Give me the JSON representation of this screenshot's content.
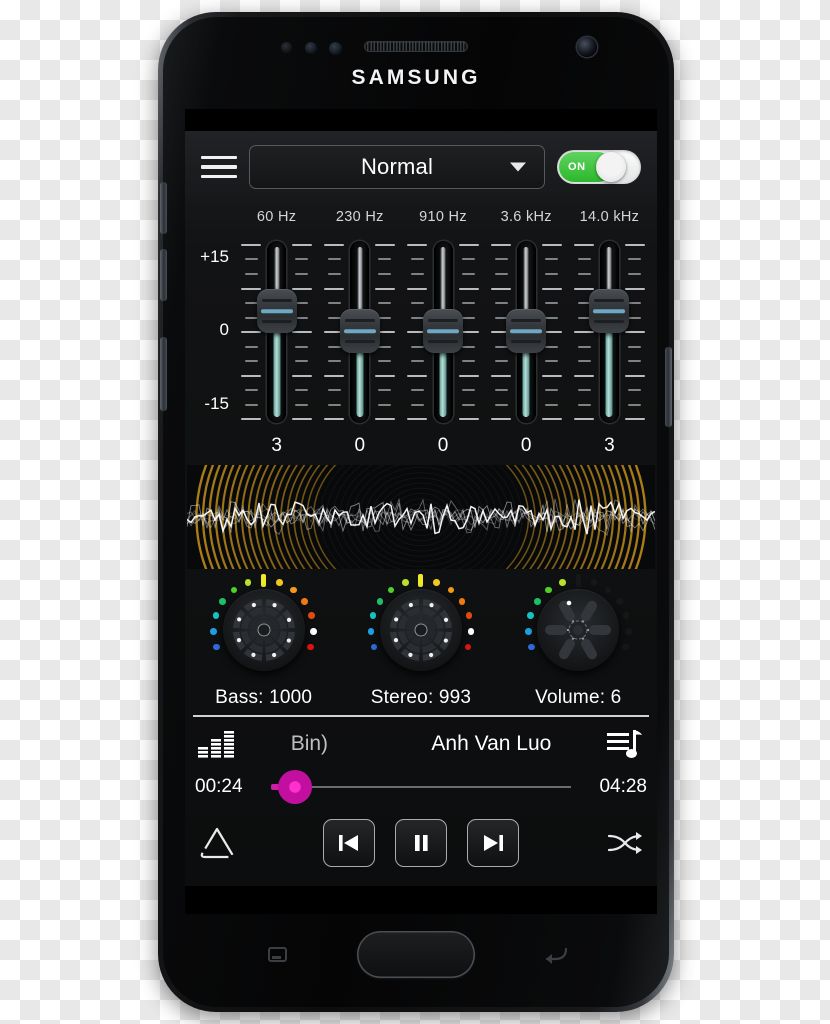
{
  "device": {
    "brand": "SAMSUNG",
    "earpiece": "earpiece-speaker",
    "front_camera": "front-camera",
    "home_button": "home-button",
    "recents_key": "recents-icon",
    "back_key": "back-icon"
  },
  "app": {
    "header": {
      "menu_icon": "hamburger-icon",
      "preset": "Normal",
      "preset_caret": "chevron-down-icon",
      "power_toggle": {
        "label": "ON",
        "state": "on",
        "color": "#2cb82c"
      }
    },
    "equalizer": {
      "axis": {
        "top": "+15",
        "mid": "0",
        "bottom": "-15"
      },
      "bands": [
        {
          "freq": "60 Hz",
          "value": "3",
          "gain": 3
        },
        {
          "freq": "230 Hz",
          "value": "0",
          "gain": 0
        },
        {
          "freq": "910 Hz",
          "value": "0",
          "gain": 0
        },
        {
          "freq": "3.6 kHz",
          "value": "0",
          "gain": 0
        },
        {
          "freq": "14.0 kHz",
          "value": "3",
          "gain": 3
        }
      ],
      "range": [
        -15,
        15
      ],
      "fill_color": "#b6ded7",
      "thumb_line_color": "#6fa8c4"
    },
    "visualizer": {
      "name": "audio-visualizer",
      "wave_color": "#ffffff",
      "ring_color": "#c8921a"
    },
    "knobs": [
      {
        "name": "bass-knob",
        "label": "Bass: 1000",
        "title": "Bass",
        "value": 1000,
        "style": "radial",
        "lit": 13
      },
      {
        "name": "stereo-knob",
        "label": "Stereo: 993",
        "title": "Stereo",
        "value": 993,
        "style": "radial",
        "lit": 13
      },
      {
        "name": "volume-knob",
        "label": "Volume: 6",
        "title": "Volume",
        "value": 6,
        "style": "fan",
        "lit": 6
      }
    ],
    "player": {
      "eq_bars_icon": "equalizer-bars-icon",
      "playlist_icon": "playlist-music-icon",
      "track_tail": "Bin)",
      "track_title": "Anh Van Luo",
      "elapsed": "00:24",
      "duration": "04:28",
      "progress_percent": 8,
      "progress_color": "#cc1fa8",
      "repeat_icon": "repeat-icon",
      "shuffle_icon": "shuffle-icon",
      "previous_icon": "skip-previous-icon",
      "pause_icon": "pause-icon",
      "next_icon": "skip-next-icon"
    }
  }
}
